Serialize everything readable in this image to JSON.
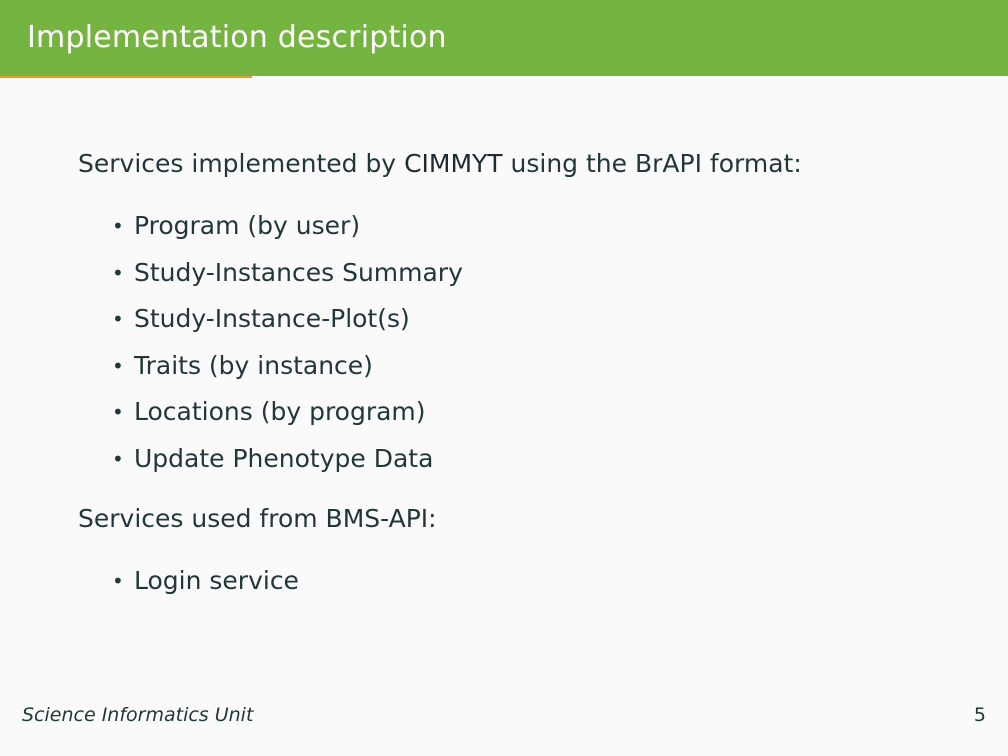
{
  "slide": {
    "title": "Implementation description",
    "intro": {
      "before": "Services implemented by ",
      "emphasis": "CIMMYT",
      "after": " using the BrAPI format:"
    },
    "implemented_services": [
      "Program (by user)",
      "Study-Instances Summary",
      "Study-Instance-Plot(s)",
      "Traits (by instance)",
      "Locations (by program)",
      "Update Phenotype Data"
    ],
    "used_heading": "Services used from BMS-API:",
    "used_services": [
      "Login service"
    ]
  },
  "footer": {
    "left": "Science Informatics Unit",
    "page_number": "5"
  },
  "colors": {
    "header": "#76b442",
    "accent_rule": "#e49b2f",
    "background": "#fafafa",
    "text": "#23373b"
  },
  "icons": {
    "bullet": "bullet-dot-icon"
  }
}
